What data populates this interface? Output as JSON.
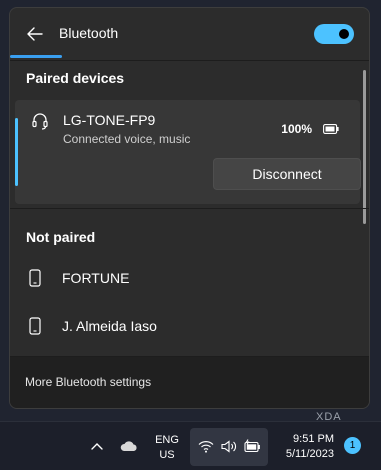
{
  "header": {
    "title": "Bluetooth",
    "toggle_on": true
  },
  "paired": {
    "section_label": "Paired devices",
    "devices": [
      {
        "name": "LG-TONE-FP9",
        "status": "Connected voice, music",
        "battery": "100%",
        "action_label": "Disconnect",
        "icon": "headset-icon"
      }
    ]
  },
  "not_paired": {
    "section_label": "Not paired",
    "devices": [
      {
        "name": "FORTUNE",
        "icon": "phone-icon"
      },
      {
        "name": "J. Almeida Iaso",
        "icon": "phone-icon"
      }
    ]
  },
  "footer": {
    "link_label": "More Bluetooth settings"
  },
  "taskbar": {
    "lang_line1": "ENG",
    "lang_line2": "US",
    "time": "9:51 PM",
    "date": "5/11/2023",
    "notification_count": "1",
    "icons": [
      "chevron-up-icon",
      "onedrive-cloud-icon",
      "wifi-icon",
      "volume-icon",
      "battery-charging-icon"
    ]
  },
  "watermark": "XDA",
  "colors": {
    "accent": "#4cc2ff",
    "panel": "#2c2c2c",
    "card": "#373737"
  }
}
